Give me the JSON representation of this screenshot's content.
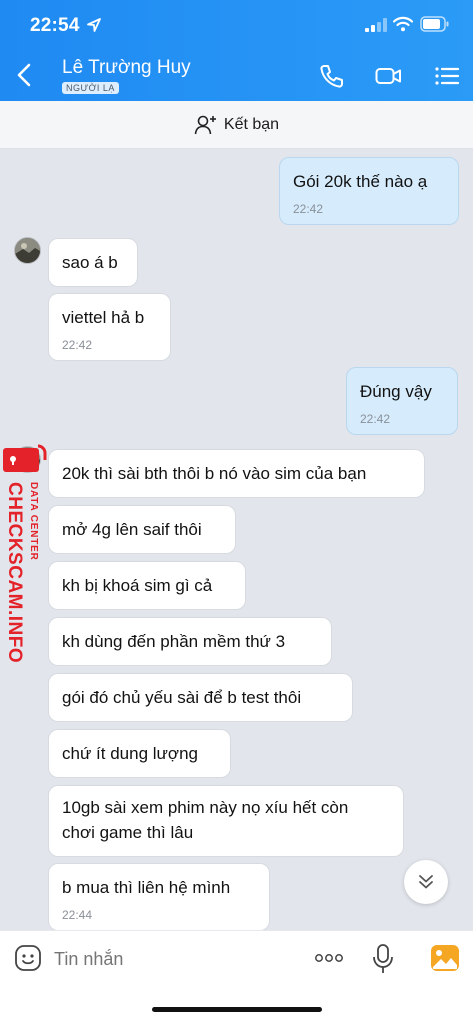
{
  "status_bar": {
    "time": "22:54"
  },
  "header": {
    "contact_name": "Lê Trường Huy",
    "badge": "NGƯỜI LẠ",
    "icons": [
      "chevron-left-icon",
      "phone-icon",
      "video-camera-icon",
      "menu-list-icon"
    ]
  },
  "add_friend": {
    "label": "Kết bạn"
  },
  "messages": [
    {
      "dir": "out",
      "text": "Gói 20k thế nào ạ",
      "time": "22:42"
    },
    {
      "dir": "in",
      "text": "sao á b",
      "time": ""
    },
    {
      "dir": "in",
      "text": "viettel hả b",
      "time": "22:42"
    },
    {
      "dir": "out",
      "text": "Đúng vậy",
      "time": "22:42"
    },
    {
      "dir": "in",
      "text": "20k thì sài bth thôi b nó vào sim của bạn",
      "time": ""
    },
    {
      "dir": "in",
      "text": "mở 4g lên saif thôi",
      "time": ""
    },
    {
      "dir": "in",
      "text": "kh bị khoá sim gì cả",
      "time": ""
    },
    {
      "dir": "in",
      "text": "kh dùng đến phần mềm thứ 3",
      "time": ""
    },
    {
      "dir": "in",
      "text": "gói đó chủ yếu sài để b test thôi",
      "time": ""
    },
    {
      "dir": "in",
      "text": "chứ ít dung lượng",
      "time": ""
    },
    {
      "dir": "in",
      "text_line1": "10gb sài xem phim này nọ xíu hết còn",
      "text_line2": "chơi game thì lâu",
      "time": ""
    },
    {
      "dir": "in",
      "text": "b mua thì liên hệ mình",
      "time": "22:44"
    }
  ],
  "watermark": {
    "main": "CHECKSCAM.INFO",
    "sub": "DATA CENTER"
  },
  "input": {
    "placeholder": "Tin nhắn"
  },
  "colors": {
    "header": "#2393f5",
    "outgoing_bubble": "#d6ecfc",
    "incoming_bubble": "#ffffff",
    "background": "#e2e6ec",
    "watermark": "#e4222a"
  }
}
